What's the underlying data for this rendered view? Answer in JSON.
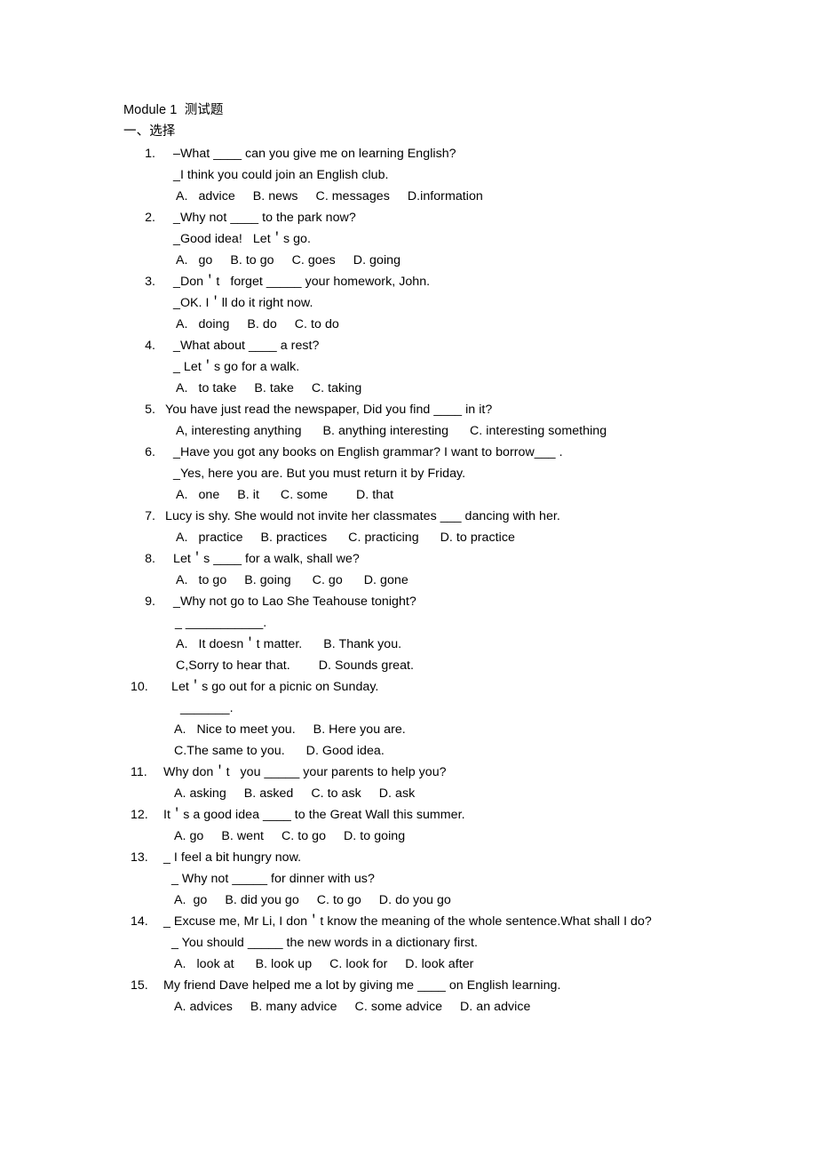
{
  "document": {
    "title": "Module 1  测试题",
    "section_heading": "一、选择"
  },
  "questions": [
    {
      "number": "1.",
      "lines": [
        "–What ____ can you give me on learning English?",
        "_I think you could join an English club.",
        "A.   advice     B. news     C. messages     D.information"
      ]
    },
    {
      "number": "2.",
      "lines": [
        "_Why not ____ to the park now?",
        "_Good idea!   Let＇s go.",
        "A.   go     B. to go     C. goes     D. going"
      ]
    },
    {
      "number": "3.",
      "lines": [
        "_Don＇t   forget _____ your homework, John.",
        "_OK. I＇ll do it right now.",
        "A.   doing     B. do     C. to do"
      ]
    },
    {
      "number": "4.",
      "lines": [
        "_What about ____ a rest?",
        "_ Let＇s go for a walk.",
        "A.   to take     B. take     C. taking"
      ]
    },
    {
      "number": "5.",
      "lines": [
        "You have just read the newspaper, Did you find ____ in it?",
        "A, interesting anything      B. anything interesting      C. interesting something"
      ]
    },
    {
      "number": "6.",
      "lines": [
        "_Have you got any books on English grammar? I want to borrow___ .",
        "_Yes, here you are. But you must return it by Friday.",
        "A.   one     B. it      C. some        D. that"
      ]
    },
    {
      "number": "7.",
      "lines": [
        "Lucy is shy. She would not invite her classmates ___ dancing with her.",
        "A.   practice     B. practices      C. practicing      D. to practice"
      ]
    },
    {
      "number": "8.",
      "lines": [
        "Let＇s ____ for a walk, shall we?",
        "A.   to go     B. going      C. go      D. gone"
      ]
    },
    {
      "number": "9.",
      "lines": [
        "_Why not go to Lao She Teahouse tonight?",
        "_ ___________.",
        "A.   It doesn＇t matter.      B. Thank you.",
        "C,Sorry to hear that.        D. Sounds great."
      ]
    },
    {
      "number": "10.",
      "lines": [
        "Let＇s go out for a picnic on Sunday.",
        "_______.",
        "A.   Nice to meet you.     B. Here you are.",
        "C.The same to you.      D. Good idea."
      ]
    },
    {
      "number": "11.",
      "lines": [
        "Why don＇t   you _____ your parents to help you?",
        "A. asking     B. asked     C. to ask     D. ask"
      ]
    },
    {
      "number": "12.",
      "lines": [
        "It＇s a good idea ____ to the Great Wall this summer.",
        "A. go     B. went     C. to go     D. to going"
      ]
    },
    {
      "number": "13.",
      "lines": [
        "_ I feel a bit hungry now.",
        "_ Why not _____ for dinner with us?",
        "A.  go     B. did you go     C. to go     D. do you go"
      ]
    },
    {
      "number": "14.",
      "lines": [
        "_ Excuse me, Mr Li, I don＇t know the meaning of the whole sentence.What shall I do?",
        "_ You should _____ the new words in a dictionary first.",
        "A.   look at      B. look up     C. look for     D. look after"
      ]
    },
    {
      "number": "15.",
      "lines": [
        "My friend Dave helped me a lot by giving me ____ on English learning.",
        "A. advices     B. many advice     C. some advice     D. an advice"
      ]
    }
  ]
}
